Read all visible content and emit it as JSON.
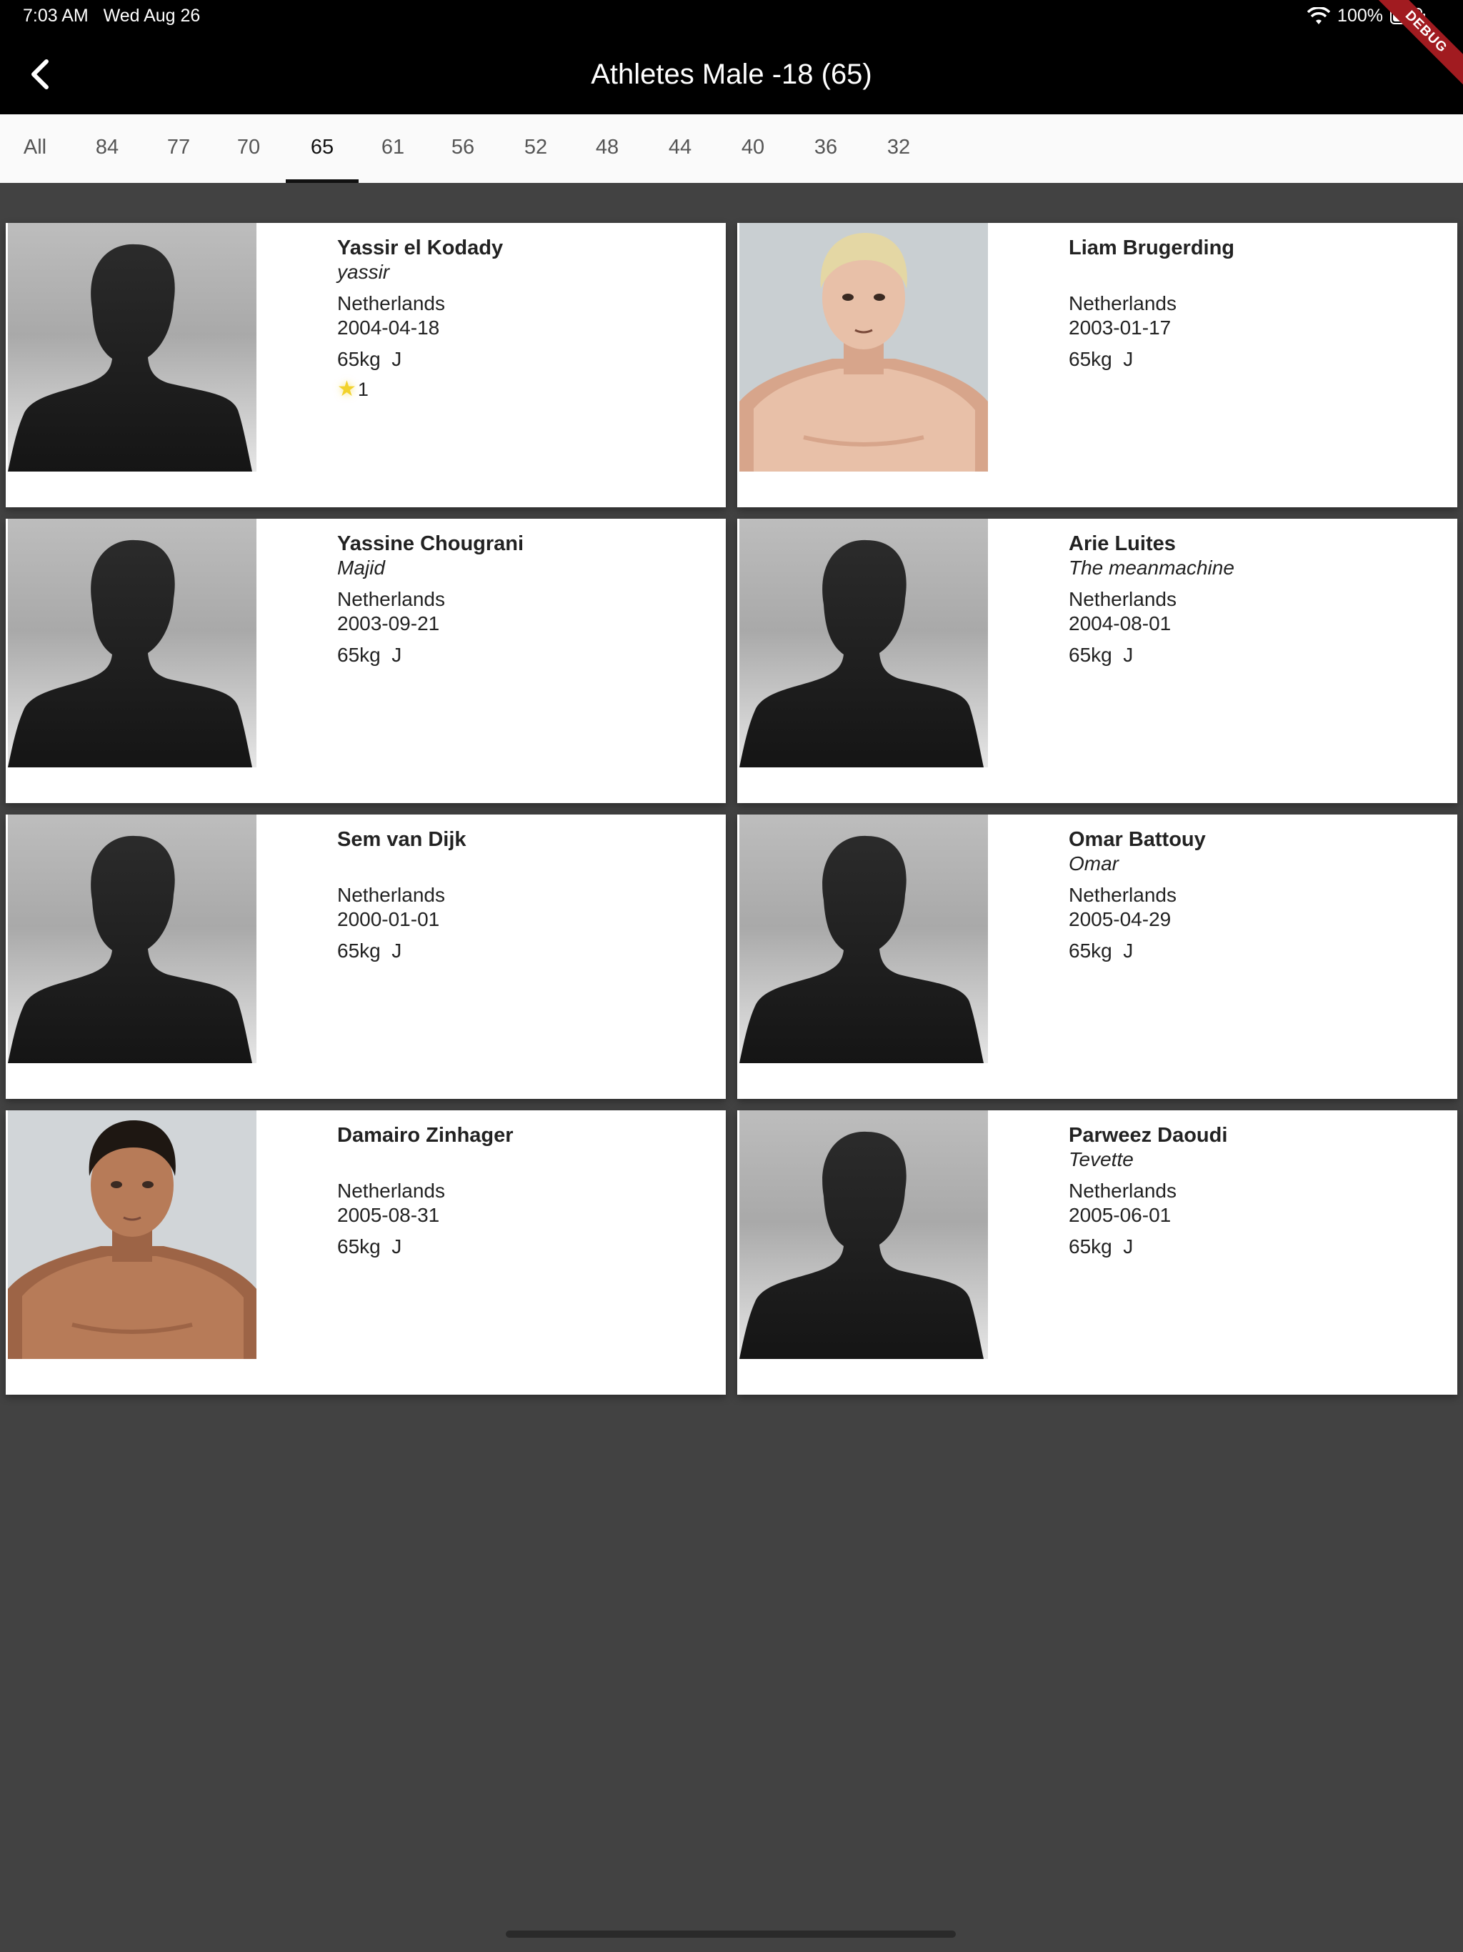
{
  "status_bar": {
    "time": "7:03 AM",
    "date": "Wed Aug 26",
    "battery": "100%",
    "debug_label": "DEBUG"
  },
  "header": {
    "title": "Athletes Male -18 (65)",
    "back_icon": "chevron-left-icon"
  },
  "tabs": [
    {
      "label": "All"
    },
    {
      "label": "84"
    },
    {
      "label": "77"
    },
    {
      "label": "70"
    },
    {
      "label": "65",
      "active": true
    },
    {
      "label": "61"
    },
    {
      "label": "56"
    },
    {
      "label": "52"
    },
    {
      "label": "48"
    },
    {
      "label": "44"
    },
    {
      "label": "40"
    },
    {
      "label": "36"
    },
    {
      "label": "32"
    }
  ],
  "athletes": [
    {
      "name": "Yassir el Kodady",
      "nickname": "yassir",
      "country": "Netherlands",
      "birthdate": "2004-04-18",
      "weight": "65kg",
      "category": "J",
      "rating": "1",
      "photo": "silhouette"
    },
    {
      "name": "Liam Brugerding",
      "nickname": "",
      "country": "Netherlands",
      "birthdate": "2003-01-17",
      "weight": "65kg",
      "category": "J",
      "photo": "portrait-blond"
    },
    {
      "name": "Yassine Chougrani",
      "nickname": "Majid",
      "country": "Netherlands",
      "birthdate": "2003-09-21",
      "weight": "65kg",
      "category": "J",
      "photo": "silhouette"
    },
    {
      "name": "Arie Luites",
      "nickname": "The meanmachine",
      "country": "Netherlands",
      "birthdate": "2004-08-01",
      "weight": "65kg",
      "category": "J",
      "photo": "silhouette"
    },
    {
      "name": "Sem van Dijk",
      "nickname": "",
      "country": "Netherlands",
      "birthdate": "2000-01-01",
      "weight": "65kg",
      "category": "J",
      "photo": "silhouette"
    },
    {
      "name": "Omar Battouy",
      "nickname": "Omar",
      "country": "Netherlands",
      "birthdate": "2005-04-29",
      "weight": "65kg",
      "category": "J",
      "photo": "silhouette"
    },
    {
      "name": "Damairo Zinhager",
      "nickname": "",
      "country": "Netherlands",
      "birthdate": "2005-08-31",
      "weight": "65kg",
      "category": "J",
      "photo": "portrait-dark"
    },
    {
      "name": "Parweez Daoudi",
      "nickname": "Tevette",
      "country": "Netherlands",
      "birthdate": "2005-06-01",
      "weight": "65kg",
      "category": "J",
      "photo": "silhouette"
    }
  ],
  "colors": {
    "background": "#424242",
    "header": "#000000",
    "tabbar": "#fafafa",
    "card": "#ffffff",
    "star": "#f2d22c"
  }
}
